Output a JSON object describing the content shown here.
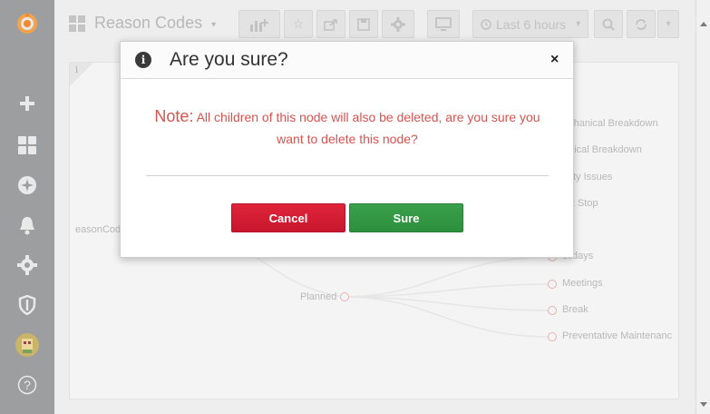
{
  "sidebar": {
    "icons": [
      "grafana-logo-icon",
      "plus-icon",
      "dashboards-grid-icon",
      "compass-icon",
      "bell-icon",
      "gear-icon",
      "shield-icon",
      "user-avatar-icon",
      "help-icon"
    ],
    "help_label": "?"
  },
  "navbar": {
    "dashboard_title": "Reason Codes",
    "time_range": "Last 6 hours"
  },
  "panel": {
    "info_label": "i",
    "tree": {
      "root": "easonCode",
      "planned": "Planned",
      "top_children": [
        "echanical Breakdown",
        "ctrical Breakdown",
        "ality Issues",
        "ort Stop"
      ],
      "planned_children": [
        "olidays",
        "Meetings",
        "Break",
        "Preventative Maintenanc"
      ]
    }
  },
  "modal": {
    "icon_label": "i",
    "title": "Are you sure?",
    "close_label": "×",
    "note_label": "Note:",
    "message": " All children of this node will also be deleted, are you sure you want to delete this node?",
    "cancel_label": "Cancel",
    "sure_label": "Sure"
  },
  "colors": {
    "sidebar": "#9d9e9f",
    "warning_text": "#d9534f",
    "cancel_button": "#d81f35",
    "sure_button": "#34994a"
  }
}
